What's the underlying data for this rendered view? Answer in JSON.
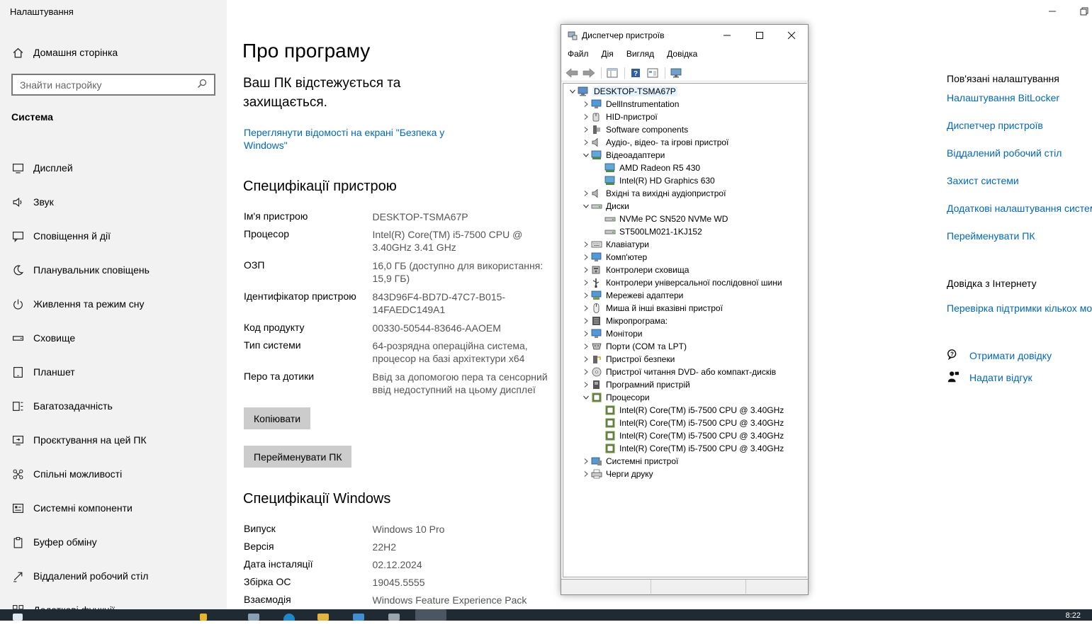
{
  "settings": {
    "app_title": "Налаштування",
    "home": "Домашня сторінка",
    "search_placeholder": "Знайти настройку",
    "section": "Система",
    "nav": [
      {
        "label": "Дисплей",
        "icon": "monitor-icon"
      },
      {
        "label": "Звук",
        "icon": "speaker-icon"
      },
      {
        "label": "Сповіщення й дії",
        "icon": "notification-icon"
      },
      {
        "label": "Планувальник сповіщень",
        "icon": "moon-icon"
      },
      {
        "label": "Живлення та режим сну",
        "icon": "power-icon"
      },
      {
        "label": "Сховище",
        "icon": "storage-icon"
      },
      {
        "label": "Планшет",
        "icon": "tablet-icon"
      },
      {
        "label": "Багатозадачність",
        "icon": "multitask-icon"
      },
      {
        "label": "Проєктування на цей ПК",
        "icon": "project-icon"
      },
      {
        "label": "Спільні можливості",
        "icon": "shared-icon"
      },
      {
        "label": "Системні компоненти",
        "icon": "components-icon"
      },
      {
        "label": "Буфер обміну",
        "icon": "clipboard-icon"
      },
      {
        "label": "Віддалений робочий стіл",
        "icon": "remote-desktop-icon"
      },
      {
        "label": "Додаткові функції",
        "icon": "features-icon"
      }
    ],
    "page_title": "Про програму",
    "protection_text": "Ваш ПК відстежується та захищається.",
    "security_link": "Переглянути відомості на екрані \"Безпека у Windows\"",
    "device_specs_title": "Специфікації пристрою",
    "device_specs": [
      {
        "label": "Ім'я пристрою",
        "value": "DESKTOP-TSMA67P"
      },
      {
        "label": "Процесор",
        "value": "Intel(R) Core(TM) i5-7500 CPU @ 3.40GHz 3.41 GHz"
      },
      {
        "label": "ОЗП",
        "value": "16,0 ГБ (доступно для використання: 15,9 ГБ)"
      },
      {
        "label": "Ідентифікатор пристрою",
        "value": "843D96F4-BD7D-47C7-B015-14FAEDC149A1"
      },
      {
        "label": "Код продукту",
        "value": "00330-50544-83646-AAOEM"
      },
      {
        "label": "Тип системи",
        "value": "64-розрядна операційна система, процесор на базі архітектури x64"
      },
      {
        "label": "Перо та дотики",
        "value": "Ввід за допомогою пера та сенсорний ввід недоступний на цьому дисплеї"
      }
    ],
    "copy_button": "Копіювати",
    "rename_button": "Перейменувати ПК",
    "windows_specs_title": "Специфікації Windows",
    "windows_specs": [
      {
        "label": "Випуск",
        "value": "Windows 10 Pro"
      },
      {
        "label": "Версія",
        "value": "22H2"
      },
      {
        "label": "Дата інсталяції",
        "value": "02.12.2024"
      },
      {
        "label": "Збірка ОС",
        "value": "19045.5555"
      },
      {
        "label": "Взаємодія",
        "value": "Windows Feature Experience Pack"
      }
    ],
    "related_title": "Пов'язані налаштування",
    "related_links": [
      "Налаштування BitLocker",
      "Диспетчер пристроїв",
      "Віддалений робочий стіл",
      "Захист системи",
      "Додаткові налаштування системи",
      "Перейменувати ПК"
    ],
    "help_title": "Довідка з Інтернету",
    "help_link": "Перевірка підтримки кількох мов",
    "get_help": "Отримати довідку",
    "feedback": "Надати відгук"
  },
  "device_manager": {
    "title": "Диспетчер пристроїв",
    "menu": [
      "Файл",
      "Дія",
      "Вигляд",
      "Довідка"
    ],
    "tree": [
      {
        "label": "DESKTOP-TSMA67P",
        "level": 0,
        "state": "expanded",
        "icon": "computer-icon"
      },
      {
        "label": "DellInstrumentation",
        "level": 1,
        "state": "collapsed",
        "icon": "monitor-icon"
      },
      {
        "label": "HID-пристрої",
        "level": 1,
        "state": "collapsed",
        "icon": "hid-icon"
      },
      {
        "label": "Software components",
        "level": 1,
        "state": "collapsed",
        "icon": "component-icon"
      },
      {
        "label": "Аудіо-, відео- та ігрові пристрої",
        "level": 1,
        "state": "collapsed",
        "icon": "speaker-icon"
      },
      {
        "label": "Відеоадаптери",
        "level": 1,
        "state": "expanded",
        "icon": "display-adapter-icon"
      },
      {
        "label": "AMD Radeon R5 430",
        "level": 2,
        "state": "leaf",
        "icon": "display-adapter-icon"
      },
      {
        "label": "Intel(R) HD Graphics 630",
        "level": 2,
        "state": "leaf",
        "icon": "display-adapter-icon"
      },
      {
        "label": "Вхідні та вихідні аудіопристрої",
        "level": 1,
        "state": "collapsed",
        "icon": "speaker-icon"
      },
      {
        "label": "Диски",
        "level": 1,
        "state": "expanded",
        "icon": "disk-icon"
      },
      {
        "label": "NVMe PC SN520 NVMe WD",
        "level": 2,
        "state": "leaf",
        "icon": "disk-icon"
      },
      {
        "label": "ST500LM021-1KJ152",
        "level": 2,
        "state": "leaf",
        "icon": "disk-icon"
      },
      {
        "label": "Клавіатури",
        "level": 1,
        "state": "collapsed",
        "icon": "keyboard-icon"
      },
      {
        "label": "Комп'ютер",
        "level": 1,
        "state": "collapsed",
        "icon": "monitor-icon"
      },
      {
        "label": "Контролери сховища",
        "level": 1,
        "state": "collapsed",
        "icon": "storage-controller-icon"
      },
      {
        "label": "Контролери універсальної послідовної шини",
        "level": 1,
        "state": "collapsed",
        "icon": "usb-icon"
      },
      {
        "label": "Мережеві адаптери",
        "level": 1,
        "state": "collapsed",
        "icon": "network-icon"
      },
      {
        "label": "Миша й інші вказівні пристрої",
        "level": 1,
        "state": "collapsed",
        "icon": "mouse-icon"
      },
      {
        "label": "Мікропрограма:",
        "level": 1,
        "state": "collapsed",
        "icon": "firmware-icon"
      },
      {
        "label": "Монітори",
        "level": 1,
        "state": "collapsed",
        "icon": "monitor-icon"
      },
      {
        "label": "Порти (COM та LPT)",
        "level": 1,
        "state": "collapsed",
        "icon": "port-icon"
      },
      {
        "label": "Пристрої безпеки",
        "level": 1,
        "state": "collapsed",
        "icon": "security-device-icon"
      },
      {
        "label": "Пристрої читання DVD- або компакт-дисків",
        "level": 1,
        "state": "collapsed",
        "icon": "dvd-icon"
      },
      {
        "label": "Програмний пристрій",
        "level": 1,
        "state": "collapsed",
        "icon": "software-device-icon"
      },
      {
        "label": "Процесори",
        "level": 1,
        "state": "expanded",
        "icon": "cpu-icon"
      },
      {
        "label": "Intel(R) Core(TM) i5-7500 CPU @ 3.40GHz",
        "level": 2,
        "state": "leaf",
        "icon": "cpu-icon"
      },
      {
        "label": "Intel(R) Core(TM) i5-7500 CPU @ 3.40GHz",
        "level": 2,
        "state": "leaf",
        "icon": "cpu-icon"
      },
      {
        "label": "Intel(R) Core(TM) i5-7500 CPU @ 3.40GHz",
        "level": 2,
        "state": "leaf",
        "icon": "cpu-icon"
      },
      {
        "label": "Intel(R) Core(TM) i5-7500 CPU @ 3.40GHz",
        "level": 2,
        "state": "leaf",
        "icon": "cpu-icon"
      },
      {
        "label": "Системні пристрої",
        "level": 1,
        "state": "collapsed",
        "icon": "system-device-icon"
      },
      {
        "label": "Черги друку",
        "level": 1,
        "state": "collapsed",
        "icon": "printer-icon"
      }
    ]
  },
  "taskbar": {
    "time": "8:22"
  }
}
